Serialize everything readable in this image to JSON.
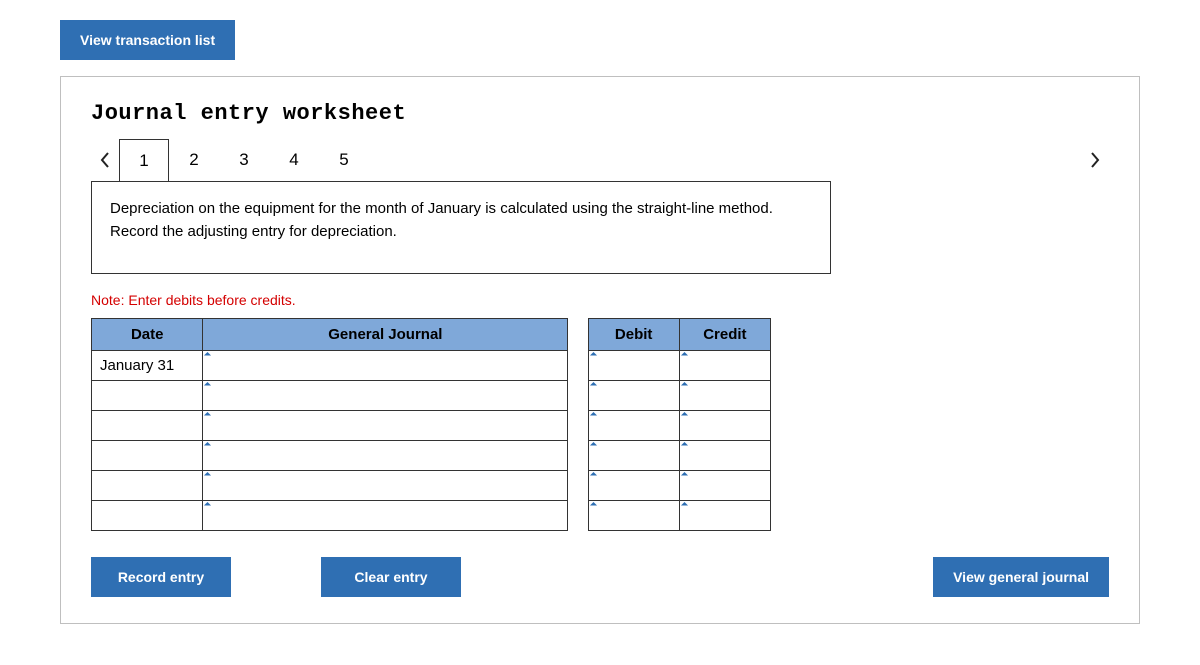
{
  "top_button": {
    "label": "View transaction list"
  },
  "worksheet": {
    "title": "Journal entry worksheet",
    "tabs": [
      "1",
      "2",
      "3",
      "4",
      "5"
    ],
    "active_tab_index": 0,
    "instruction": "Depreciation on the equipment for the month of January is calculated using the straight-line method. Record the adjusting entry for depreciation.",
    "note": "Note: Enter debits before credits.",
    "headers": {
      "date": "Date",
      "general_journal": "General Journal",
      "debit": "Debit",
      "credit": "Credit"
    },
    "rows": [
      {
        "date": "January 31",
        "general_journal": "",
        "debit": "",
        "credit": ""
      },
      {
        "date": "",
        "general_journal": "",
        "debit": "",
        "credit": ""
      },
      {
        "date": "",
        "general_journal": "",
        "debit": "",
        "credit": ""
      },
      {
        "date": "",
        "general_journal": "",
        "debit": "",
        "credit": ""
      },
      {
        "date": "",
        "general_journal": "",
        "debit": "",
        "credit": ""
      },
      {
        "date": "",
        "general_journal": "",
        "debit": "",
        "credit": ""
      }
    ],
    "buttons": {
      "record": "Record entry",
      "clear": "Clear entry",
      "view_journal": "View general journal"
    }
  }
}
